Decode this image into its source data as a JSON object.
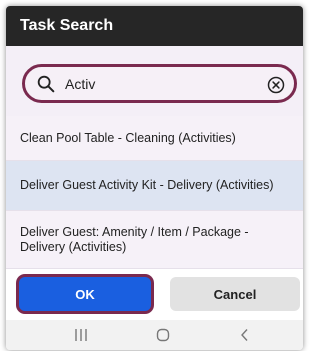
{
  "dialog": {
    "title": "Task Search"
  },
  "search": {
    "value": "Activ"
  },
  "results": [
    {
      "label": "Clean Pool Table - Cleaning (Activities)",
      "selected": false
    },
    {
      "label": "Deliver Guest Activity Kit - Delivery (Activities)",
      "selected": true
    },
    {
      "label": "Deliver Guest: Amenity / Item / Package - Delivery (Activities)",
      "selected": false
    }
  ],
  "buttons": {
    "ok_label": "OK",
    "cancel_label": "Cancel"
  },
  "colors": {
    "titlebar": "#262626",
    "accent_border": "#7a2a4f",
    "primary_button": "#1a5fe0",
    "selected_row": "#dde4f2"
  },
  "icons": {
    "search": "search-icon",
    "clear": "clear-icon",
    "nav_recent": "recent-apps-icon",
    "nav_home": "home-icon",
    "nav_back": "back-icon"
  }
}
